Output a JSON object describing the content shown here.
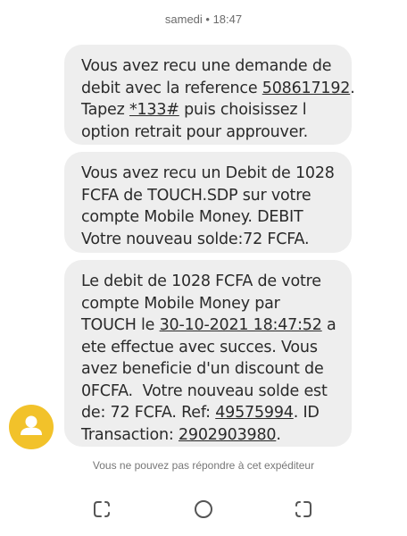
{
  "header": {
    "timestamp": "samedi • 18:47"
  },
  "messages": [
    {
      "lines": [
        [
          "Vous avez recu une demande de"
        ],
        [
          "debit avec la reference ",
          {
            "u": "508617192"
          },
          "."
        ],
        [
          "Tapez ",
          {
            "u": "*133#"
          },
          " puis choisissez l"
        ],
        [
          "option retrait pour approuver."
        ]
      ]
    },
    {
      "lines": [
        [
          "Vous avez recu un Debit de 1028"
        ],
        [
          "FCFA de TOUCH.SDP sur votre"
        ],
        [
          "compte Mobile Money. DEBIT"
        ],
        [
          "Votre nouveau solde:72 FCFA."
        ]
      ]
    },
    {
      "lines": [
        [
          "Le debit de 1028 FCFA de votre"
        ],
        [
          "compte Mobile Money par"
        ],
        [
          "TOUCH le ",
          {
            "u": "30-10-2021 18:47:52"
          },
          " a"
        ],
        [
          "ete effectue avec succes. Vous"
        ],
        [
          "avez beneficie d'un discount de"
        ],
        [
          "0FCFA.  Votre nouveau solde est"
        ],
        [
          "de: 72 FCFA. Ref: ",
          {
            "u": "49575994"
          },
          ". ID"
        ],
        [
          "Transaction: ",
          {
            "u": "2902903980"
          },
          "."
        ]
      ]
    }
  ],
  "sender": {
    "icon": "person-icon",
    "avatar_color": "#f2c22a"
  },
  "footer": {
    "note": "Vous ne pouvez pas répondre à cet expéditeur"
  },
  "navbar": {
    "recents_icon": "recents-icon",
    "home_icon": "home-icon",
    "back_icon": "back-icon"
  }
}
